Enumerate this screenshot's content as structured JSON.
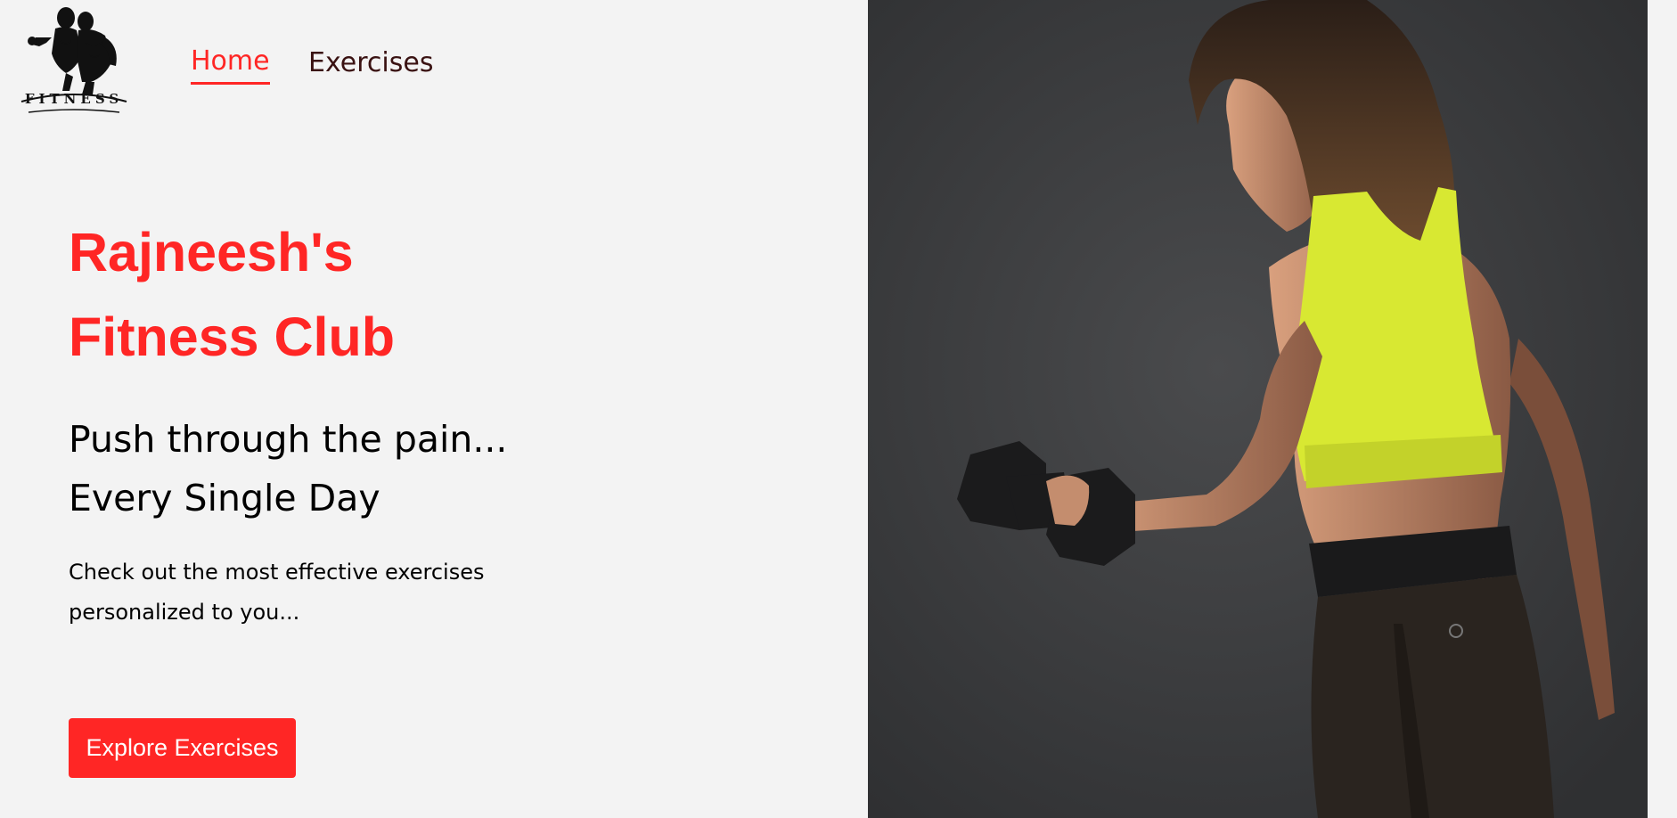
{
  "logo": {
    "text": "FITNESS",
    "icon": "bodybuilder-couple-logo"
  },
  "nav": {
    "items": [
      {
        "label": "Home",
        "active": true
      },
      {
        "label": "Exercises",
        "active": false
      }
    ]
  },
  "hero": {
    "title_line1": "Rajneesh's",
    "title_line2": "Fitness Club",
    "subtitle_line1": "Push through the pain...",
    "subtitle_line2": "Every Single Day",
    "description_line1": "Check out the most effective exercises",
    "description_line2": "personalized to you...",
    "cta_label": "Explore Exercises",
    "image": "woman-lifting-dumbbell-photo"
  },
  "colors": {
    "accent": "#ff2625",
    "background": "#f3f3f3",
    "nav_text": "#3a1212",
    "image_background": "#3b3c3e",
    "top_color": "#d8e832"
  }
}
